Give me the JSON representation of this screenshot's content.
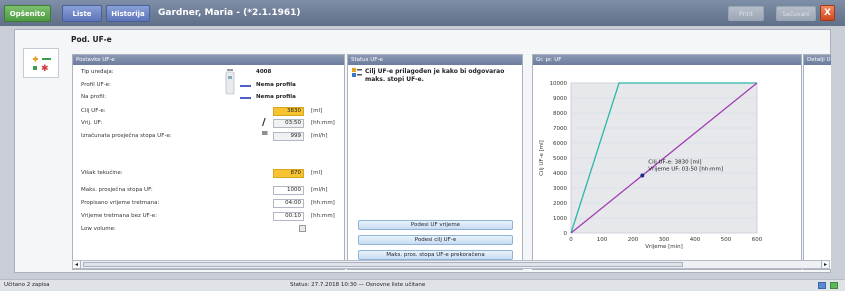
{
  "tabs": [
    {
      "label": "Opšenito"
    },
    {
      "label": "Liste"
    },
    {
      "label": "Historija"
    }
  ],
  "patient_title": "Gardner, Maria - (*2.1.1961)",
  "toolbar": {
    "print_label": "Print",
    "refresh_label": "Sačuvani",
    "close_label": "X"
  },
  "page_title": "Pod. UF-e",
  "postavke": {
    "header": "Postavke UF-e",
    "device_type_label": "Tip uređaja:",
    "device_type_value": "4008",
    "uf_profile_label": "Profil UF-e:",
    "uf_profile_value": "Nema profila",
    "on_profile_label": "Na profil:",
    "on_profile_value": "Nema profila",
    "target_uf_label": "Cilj UF-e:",
    "target_uf_value": "3830",
    "target_uf_unit": "[ml]",
    "time_uf_label": "Vrij. UF:",
    "time_uf_value": "03:50",
    "time_uf_unit": "[hh:mm]",
    "avg_rate_label": "Izračunata prosječna stopa UF-e:",
    "avg_rate_value": "999",
    "avg_rate_unit": "[ml/h]",
    "excess_label": "Višak tekućine:",
    "excess_value": "870",
    "excess_unit": "[ml]",
    "max_rate_label": "Maks. prosječna stopa UF:",
    "max_rate_value": "1000",
    "max_rate_unit": "[ml/h]",
    "prescribed_label": "Propisano vrijeme tretmana:",
    "prescribed_value": "04:00",
    "prescribed_unit": "[hh:mm]",
    "no_uf_label": "Vrijeme tretmana bez UF-e:",
    "no_uf_value": "00:10",
    "no_uf_unit": "[hh:mm]",
    "low_volume_label": "Low volume:"
  },
  "status": {
    "header": "Status UF-e",
    "message": "Cilj UF-e prilagođen je kako bi odgovarao maks. stopi UF-e.",
    "btn_time": "Podesi UF vrijeme",
    "btn_target": "Podesi cilj UF-e",
    "btn_exceeded": "Maks. pros. stopa UF-e prekoračena"
  },
  "graph": {
    "header": "Gr. pr. UF"
  },
  "details": {
    "header": "Detalji U"
  },
  "chart_data": {
    "type": "line",
    "xlabel": "Vrijeme [min]",
    "ylabel": "Cilj UF-e [ml]",
    "xlim": [
      0,
      600
    ],
    "ylim": [
      0,
      10000
    ],
    "x_ticks": [
      "0",
      "100",
      "200",
      "300",
      "400",
      "500",
      "600"
    ],
    "y_ticks": [
      "0",
      "1000",
      "2000",
      "3000",
      "4000",
      "5000",
      "6000",
      "7000",
      "8000",
      "9000",
      "10000"
    ],
    "series": [
      {
        "color": "#2bb8a8",
        "points": [
          [
            0,
            0
          ],
          [
            155,
            10000
          ],
          [
            600,
            10000
          ]
        ]
      },
      {
        "color": "#a23fb5",
        "points": [
          [
            0,
            0
          ],
          [
            600,
            10000
          ]
        ]
      }
    ],
    "marker": {
      "x": 230,
      "y": 3830
    },
    "annotation": [
      "Cilj UF-e: 3830 [ml]",
      "Vrijeme UF: 03:50 [hh:mm]"
    ],
    "grid": true
  },
  "statusbar": {
    "left": "Učitano 2 zapisa",
    "center": "Status:  27.7.2018 10:30 — Osnovne liste učitane"
  }
}
